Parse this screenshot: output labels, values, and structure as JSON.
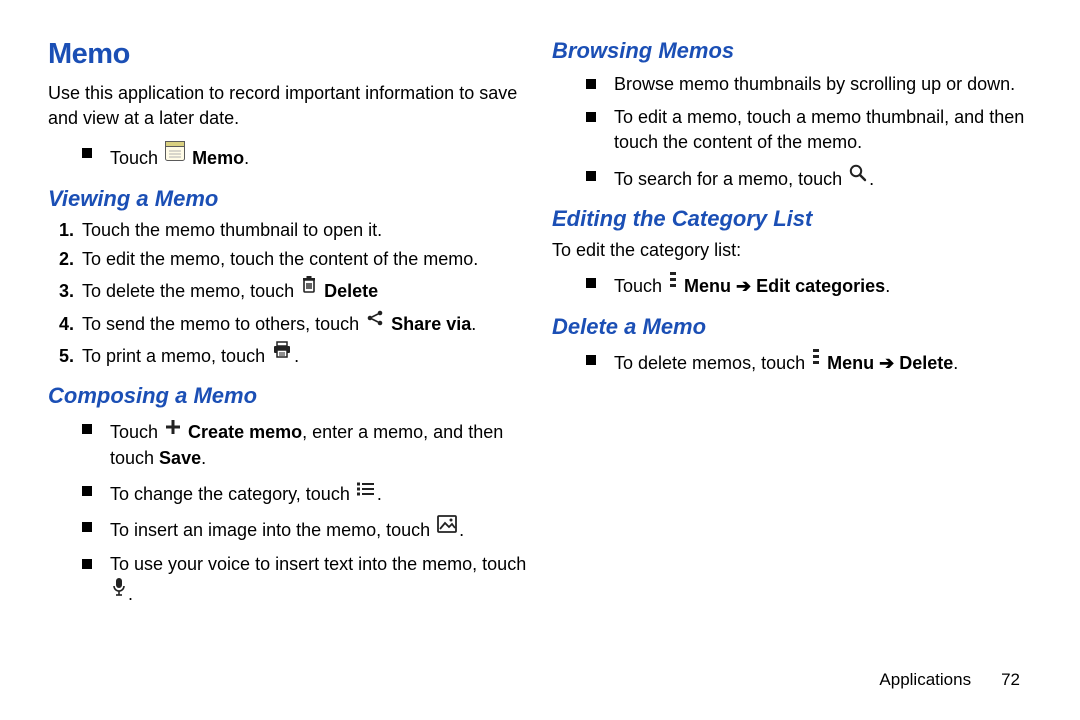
{
  "title": "Memo",
  "intro": "Use this application to record important information to save and view at a later date.",
  "touch": {
    "prefix": "Touch ",
    "label": "Memo",
    "suffix": "."
  },
  "viewing": {
    "heading": "Viewing a Memo",
    "items": [
      {
        "n": "1.",
        "text": "Touch the memo thumbnail to open it."
      },
      {
        "n": "2.",
        "text": "To edit the memo, touch the content of the memo."
      },
      {
        "n": "3.",
        "pre": "To delete the memo, touch ",
        "bold": "Delete"
      },
      {
        "n": "4.",
        "pre": "To send the memo to others, touch ",
        "bold": "Share via",
        "suf": "."
      },
      {
        "n": "5.",
        "pre": "To print a memo, touch ",
        "icon": "print",
        "suf": "."
      }
    ]
  },
  "composing": {
    "heading": "Composing a Memo",
    "items": [
      {
        "pre": "Touch ",
        "icon": "plus",
        "bold": " Create memo",
        "mid": ", enter a memo, and then touch ",
        "bold2": "Save",
        "suf": "."
      },
      {
        "pre": "To change the category, touch ",
        "icon": "list",
        "suf": "."
      },
      {
        "pre": "To insert an image into the memo, touch ",
        "icon": "image",
        "suf": "."
      },
      {
        "pre": "To use your voice to insert text into the memo, touch ",
        "icon": "mic",
        "suf": "."
      }
    ]
  },
  "browsing": {
    "heading": "Browsing Memos",
    "items": [
      {
        "text": "Browse memo thumbnails by scrolling up or down."
      },
      {
        "text": "To edit a memo, touch a memo thumbnail, and then touch the content of the memo."
      },
      {
        "pre": "To search for a memo, touch ",
        "icon": "search",
        "suf": "."
      }
    ]
  },
  "editing": {
    "heading": "Editing the Category List",
    "lead": "To edit the category list:",
    "item": {
      "pre": "Touch ",
      "icon": "menu",
      "bold": " Menu ",
      "arrow": "➔",
      "bold2": " Edit categories",
      "suf": "."
    }
  },
  "delete": {
    "heading": "Delete a Memo",
    "item": {
      "pre": "To delete memos, touch ",
      "icon": "menu",
      "bold": " Menu ",
      "arrow": "➔",
      "bold2": " Delete",
      "suf": "."
    }
  },
  "footer": {
    "label": "Applications",
    "page": "72"
  }
}
